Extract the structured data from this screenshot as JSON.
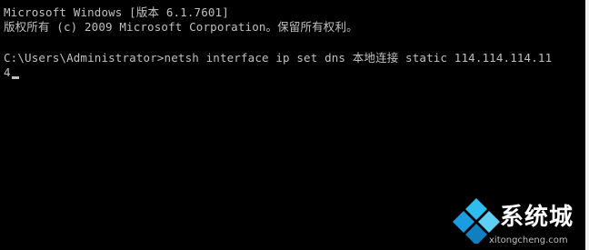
{
  "console": {
    "lines": [
      "Microsoft Windows [版本 6.1.7601]",
      "版权所有 (c) 2009 Microsoft Corporation。保留所有权利。",
      "C:\\Users\\Administrator>netsh interface ip set dns 本地连接 static 114.114.114.11",
      "4"
    ],
    "colors": {
      "background": "#000000",
      "text": "#c0c0c0"
    }
  },
  "watermark": {
    "brand": "系统城",
    "url": "xitongcheng.com",
    "logo_colors": [
      "#1a9de0",
      "#2ebdf0",
      "#0f7fc0",
      "#5fd0f5"
    ]
  }
}
